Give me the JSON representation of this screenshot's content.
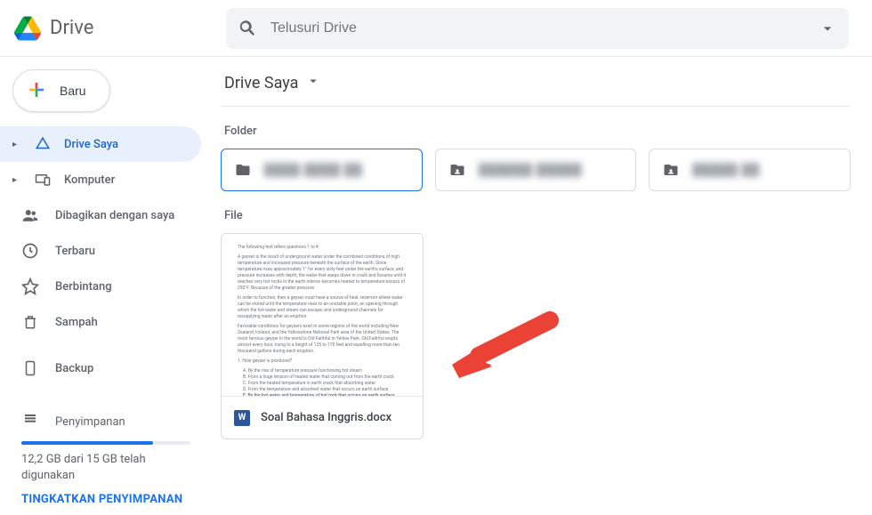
{
  "header": {
    "product": "Drive",
    "search_placeholder": "Telusuri Drive"
  },
  "sidebar": {
    "new_label": "Baru",
    "items": [
      {
        "label": "Drive Saya",
        "icon": "drive",
        "expandable": true,
        "active": true
      },
      {
        "label": "Komputer",
        "icon": "devices",
        "expandable": true,
        "active": false
      },
      {
        "label": "Dibagikan dengan saya",
        "icon": "shared",
        "expandable": false,
        "active": false
      },
      {
        "label": "Terbaru",
        "icon": "clock",
        "expandable": false,
        "active": false
      },
      {
        "label": "Berbintang",
        "icon": "star",
        "expandable": false,
        "active": false
      },
      {
        "label": "Sampah",
        "icon": "trash",
        "expandable": false,
        "active": false
      }
    ],
    "backup_label": "Backup",
    "storage": {
      "label": "Penyimpanan",
      "text": "12,2 GB dari 15 GB telah digunakan",
      "upgrade": "TINGKATKAN PENYIMPANAN"
    }
  },
  "main": {
    "title": "Drive Saya",
    "folder_section": "Folder",
    "file_section": "File",
    "folders": [
      {
        "placeholder": "████ ████ ██",
        "selected": true,
        "icon": "folder"
      },
      {
        "placeholder": "██████ █████",
        "selected": false,
        "icon": "shared-folder"
      },
      {
        "placeholder": "█████ ██",
        "selected": false,
        "icon": "shared-folder"
      }
    ],
    "files": [
      {
        "name": "Soal Bahasa Inggris.docx",
        "type": "word"
      }
    ]
  }
}
